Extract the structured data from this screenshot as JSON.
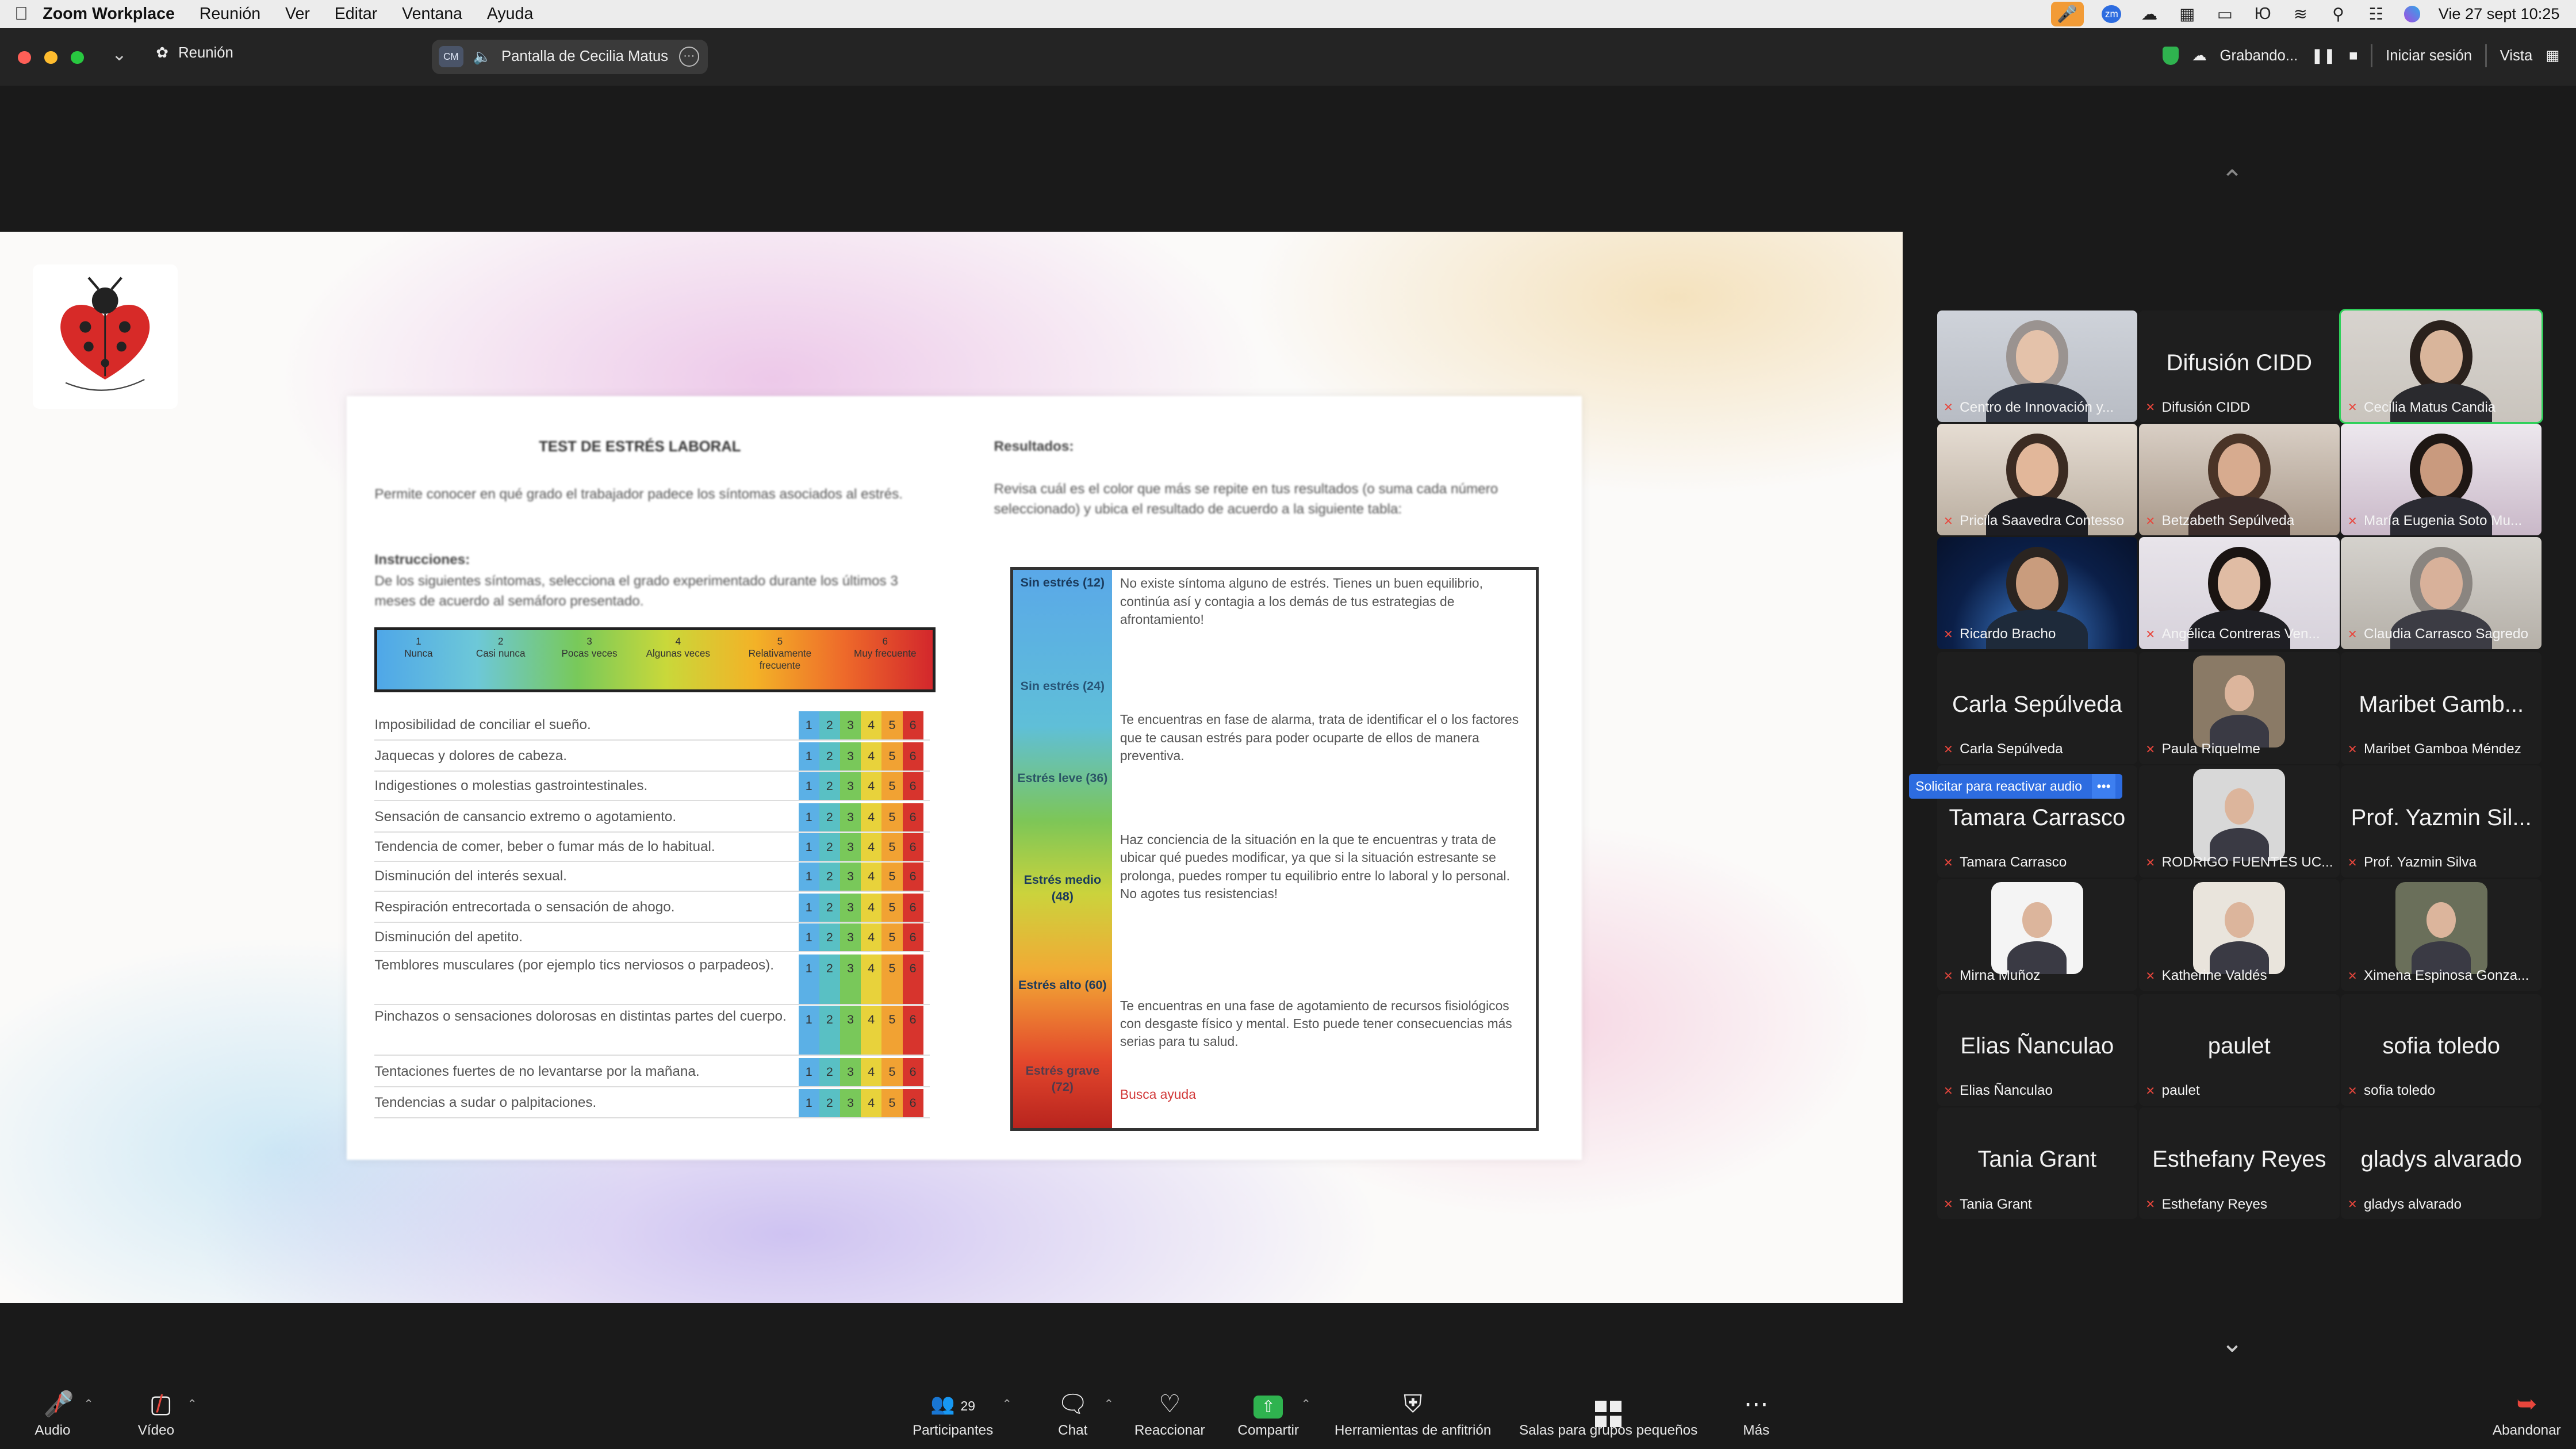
{
  "menubar": {
    "app": "Zoom Workplace",
    "items": [
      "Reunión",
      "Ver",
      "Editar",
      "Ventana",
      "Ayuda"
    ],
    "clock": "Vie 27 sept  10:25"
  },
  "titlebar": {
    "meeting_label": "Reunión",
    "share_avatar": "CM",
    "share_label": "Pantalla de Cecilia Matus",
    "recording_label": "Grabando...",
    "signin": "Iniciar sesión",
    "view": "Vista"
  },
  "doc": {
    "title": "TEST DE ESTRÉS LABORAL",
    "intro": "Permite conocer en qué grado el trabajador padece los síntomas asociados al estrés.",
    "instructions_heading": "Instrucciones:",
    "instructions": "De los siguientes síntomas, selecciona el grado experimentado durante los últimos 3 meses de acuerdo al semáforo presentado.",
    "scale": [
      {
        "n": "1",
        "label": "Nunca"
      },
      {
        "n": "2",
        "label": "Casi nunca"
      },
      {
        "n": "3",
        "label": "Pocas veces"
      },
      {
        "n": "4",
        "label": "Algunas veces"
      },
      {
        "n": "5",
        "label": "Relativamente frecuente"
      },
      {
        "n": "6",
        "label": "Muy frecuente"
      }
    ],
    "symptoms": [
      "Imposibilidad de conciliar el sueño.",
      "Jaquecas y dolores de cabeza.",
      "Indigestiones o molestias gastrointestinales.",
      "Sensación de cansancio extremo o agotamiento.",
      "Tendencia de comer, beber o fumar más de lo habitual.",
      "Disminución del interés sexual.",
      "Respiración entrecortada o sensación de ahogo.",
      "Disminución del apetito.",
      "Temblores musculares (por ejemplo tics nerviosos o parpadeos).",
      "Pinchazos o sensaciones dolorosas en distintas partes del cuerpo.",
      "Tentaciones fuertes de no levantarse por la mañana.",
      "Tendencias a sudar o palpitaciones."
    ],
    "results_heading": "Resultados:",
    "results_intro": "Revisa cuál es el color que más se repite en tus resultados (o suma cada número seleccionado) y ubica el resultado de acuerdo a la siguiente tabla:",
    "results": [
      {
        "label": "Sin estrés (12)",
        "text": "No existe síntoma alguno de estrés. Tienes un buen equilibrio, continúa así y contagia a los demás de tus estrategias de afrontamiento!"
      },
      {
        "label": "Sin estrés (24)",
        "text": "Te encuentras en fase de alarma, trata de identificar el o los factores que te causan estrés para poder ocuparte de ellos de manera preventiva."
      },
      {
        "label": "Estrés leve (36)",
        "text": "Haz conciencia de la situación en la que te encuentras y trata de ubicar qué puedes modificar, ya que si la situación estresante se prolonga, puedes romper tu equilibrio entre lo laboral y lo personal. No agotes tus resistencias!"
      },
      {
        "label": "Estrés medio (48)",
        "text": ""
      },
      {
        "label": "Estrés alto (60)",
        "text": "Te encuentras en una fase de agotamiento de recursos fisiológicos con desgaste físico y mental. Esto puede tener consecuencias más serias para tu salud."
      },
      {
        "label": "Estrés grave (72)",
        "text": "Busca ayuda"
      }
    ]
  },
  "gallery": {
    "unmute_tip": "Solicitar para reactivar audio",
    "unmute_more": "•••",
    "tiles": [
      {
        "name": "Centro de Innovación y...",
        "big": "",
        "video": "woman-headset"
      },
      {
        "name": "Difusión CIDD",
        "big": "Difusión CIDD",
        "video": ""
      },
      {
        "name": "Cecilia Matus Candia",
        "big": "",
        "video": "woman-talking"
      },
      {
        "name": "Pricila Saavedra Contesso",
        "big": "",
        "video": "woman-room"
      },
      {
        "name": "Betzabeth Sepúlveda",
        "big": "",
        "video": "woman-glasses"
      },
      {
        "name": "María  Eugenia Soto Mu...",
        "big": "",
        "video": "woman-curly"
      },
      {
        "name": "Ricardo Bracho",
        "big": "",
        "video": "man-space"
      },
      {
        "name": "Angélica Contreras Ven...",
        "big": "",
        "video": "woman-dark"
      },
      {
        "name": "Claudia Carrasco Sagredo",
        "big": "",
        "video": "woman-grey"
      },
      {
        "name": "Carla Sepúlveda",
        "big": "Carla Sepúlveda",
        "video": ""
      },
      {
        "name": "Paula Riquelme",
        "big": "",
        "video": "avatar-books"
      },
      {
        "name": "Maribet Gamboa Méndez",
        "big": "Maribet Gamb...",
        "video": ""
      },
      {
        "name": "Tamara Carrasco",
        "big": "Tamara Carrasco",
        "video": ""
      },
      {
        "name": "RODRIGO FUENTES UC...",
        "big": "",
        "video": "avatar-man-suit"
      },
      {
        "name": "Prof. Yazmin Silva",
        "big": "Prof. Yazmin Sil...",
        "video": ""
      },
      {
        "name": "Mirna Muñoz",
        "big": "",
        "video": "avatar-ucsc"
      },
      {
        "name": "Katherine Valdés",
        "big": "",
        "video": "avatar-blonde"
      },
      {
        "name": "Ximena Espinosa Gonza...",
        "big": "",
        "video": "avatar-dark-hair"
      },
      {
        "name": "Elias Ñanculao",
        "big": "Elias Ñanculao",
        "video": ""
      },
      {
        "name": "paulet",
        "big": "paulet",
        "video": ""
      },
      {
        "name": "sofia toledo",
        "big": "sofia toledo",
        "video": ""
      },
      {
        "name": "Tania Grant",
        "big": "Tania Grant",
        "video": ""
      },
      {
        "name": "Esthefany Reyes",
        "big": "Esthefany Reyes",
        "video": ""
      },
      {
        "name": "gladys alvarado",
        "big": "gladys alvarado",
        "video": ""
      }
    ]
  },
  "toolbar": {
    "audio": "Audio",
    "video": "Vídeo",
    "participants": "Participantes",
    "participants_count": "29",
    "chat": "Chat",
    "react": "Reaccionar",
    "share": "Compartir",
    "host_tools": "Herramientas de anfitrión",
    "breakout": "Salas para grupos pequeños",
    "more": "Más",
    "leave": "Abandonar"
  },
  "colors": {
    "accent_green": "#2fb34f",
    "talking_outline": "#2fd05a",
    "mic_orange": "#f29b36",
    "muted_red": "#e8463c",
    "tooltip_blue": "#2d6ce0"
  }
}
